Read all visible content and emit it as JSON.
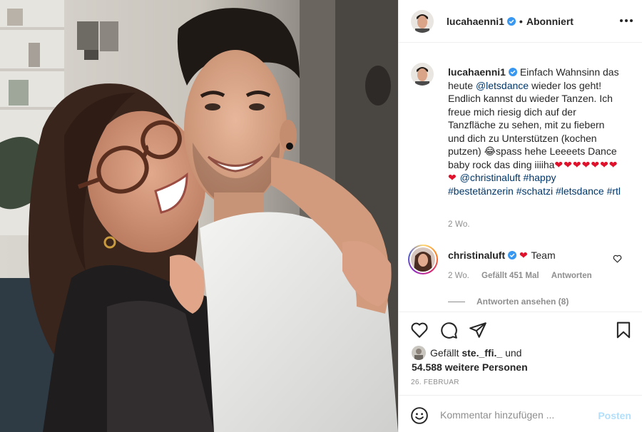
{
  "header": {
    "username": "lucahaenni1",
    "separator": "•",
    "follow_state": "Abonniert",
    "icons": {
      "verified": "verified-badge-icon",
      "more": "more-options-icon"
    }
  },
  "caption": {
    "username": "lucahaenni1",
    "text_1": "Einfach Wahnsinn das heute ",
    "mention_1": "@letsdance",
    "text_2": " wieder los geht! Endlich kannst du wieder Tanzen. Ich freue mich riesig dich auf der Tanzfläche zu sehen, mit zu fiebern und dich zu Unterstützen (kochen putzen) ",
    "emoji_1": "😂",
    "text_3": "spass hehe Leeeets Dance baby rock das ding iiiiha",
    "hearts": "❤❤❤❤❤❤❤❤",
    "mention_2": "@christinaluft",
    "tags": [
      "#happy",
      "#bestetänzerin",
      "#schatzi",
      "#letsdance",
      "#rtl"
    ],
    "time": "2 Wo."
  },
  "comment": {
    "username": "christinaluft",
    "heart": "❤",
    "text": "Team",
    "time": "2 Wo.",
    "likes": "Gefällt 451 Mal",
    "reply": "Antworten",
    "view_replies": "Antworten ansehen (8)"
  },
  "actions": {
    "icons": [
      "heart-outline-icon",
      "comment-bubble-icon",
      "share-paper-plane-icon",
      "bookmark-icon"
    ]
  },
  "likes": {
    "prefix": "Gefällt",
    "user": "ste._ffi._",
    "connector": "und",
    "others": "54.588 weitere Personen"
  },
  "date": "26. FEBRUAR",
  "add_comment": {
    "placeholder": "Kommentar hinzufügen ...",
    "post_label": "Posten"
  },
  "colors": {
    "link": "#00376b",
    "muted": "#8e8e8e",
    "verified": "#3897f0",
    "heart": "#e0112b",
    "post_disabled": "#b2dffc"
  }
}
